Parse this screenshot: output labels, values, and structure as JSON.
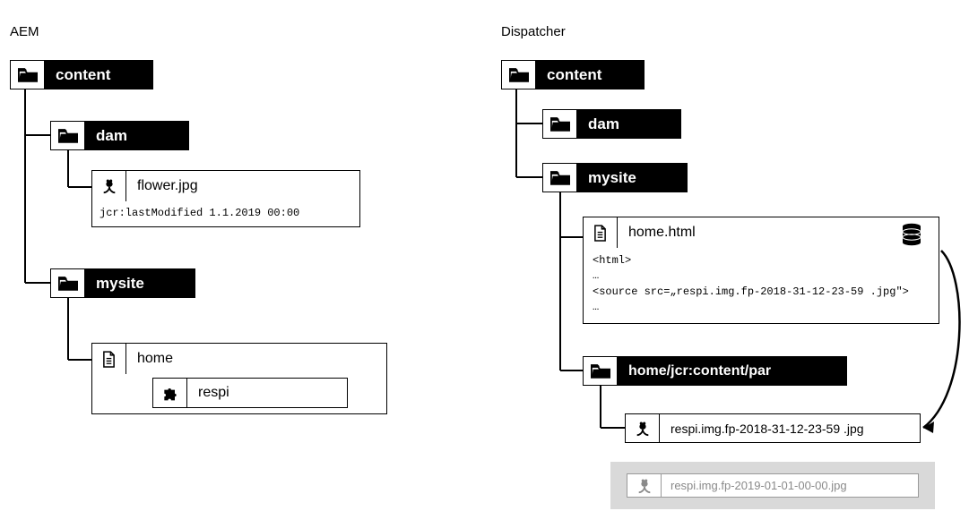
{
  "aem": {
    "title": "AEM",
    "content": "content",
    "dam": "dam",
    "flower_file": "flower.jpg",
    "flower_meta": "jcr:lastModified 1.1.2019 00:00",
    "mysite": "mysite",
    "home": "home",
    "respi": "respi"
  },
  "disp": {
    "title": "Dispatcher",
    "content": "content",
    "dam": "dam",
    "mysite": "mysite",
    "home_html": "home.html",
    "home_code_l1": "<html>",
    "home_code_l2": "…",
    "home_code_l3": "<source src=„respi.img.fp-2018-31-12-23-59 .jpg\">",
    "home_code_l4": "…",
    "par_folder": "home/jcr:content/par",
    "respi_file": "respi.img.fp-2018-31-12-23-59 .jpg",
    "ghost_file": "respi.img.fp-2019-01-01-00-00.jpg"
  }
}
